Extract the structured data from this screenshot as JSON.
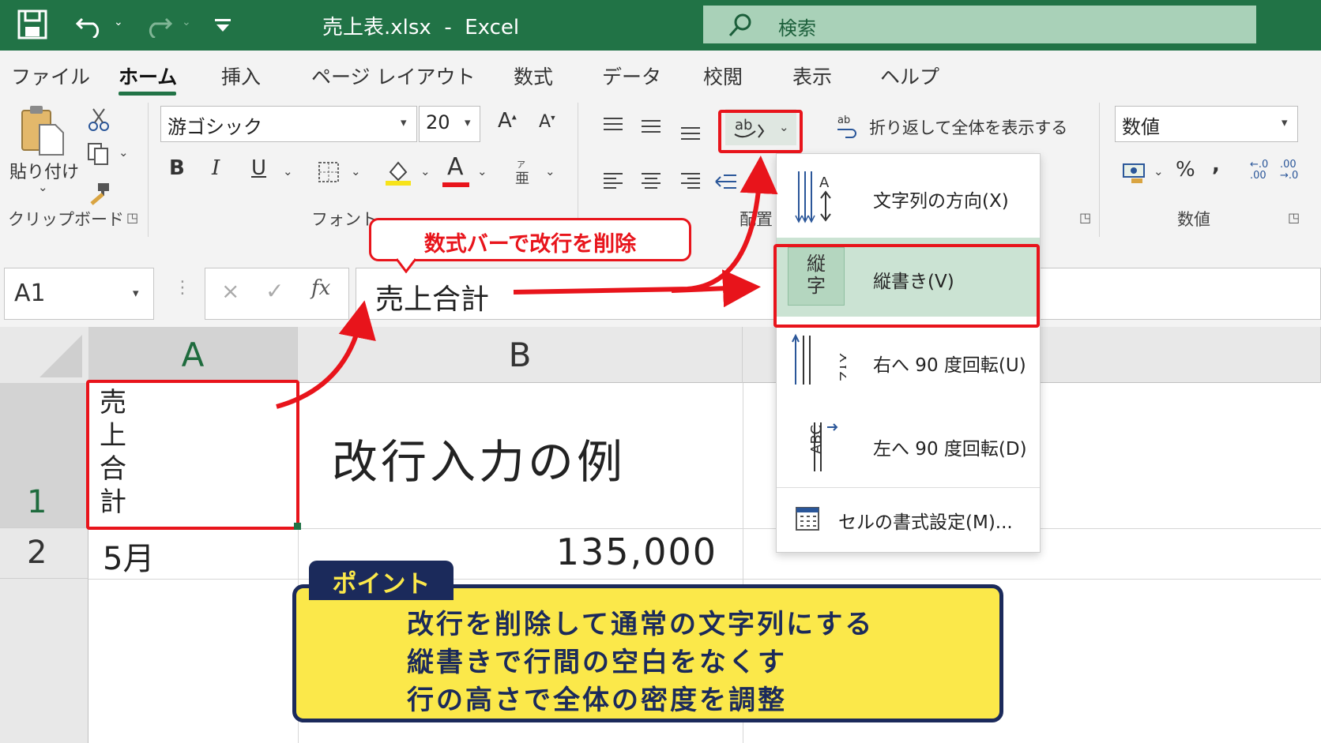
{
  "window": {
    "title": "売上表.xlsx  -  Excel"
  },
  "search": {
    "label": "検索"
  },
  "menu": {
    "items": [
      "ファイル",
      "ホーム",
      "挿入",
      "ページ レイアウト",
      "数式",
      "データ",
      "校閲",
      "表示",
      "ヘルプ"
    ],
    "active": "ホーム"
  },
  "ribbon": {
    "clipboard": {
      "paste_label": "貼り付け",
      "group_label": "クリップボード"
    },
    "font": {
      "font_name": "游ゴシック",
      "font_size": "20",
      "grow": "A",
      "shrink": "A",
      "bold": "B",
      "italic": "I",
      "underline": "U",
      "font_color_letter": "A",
      "group_label": "フォント"
    },
    "alignment": {
      "orientation_label": "ab",
      "wrap_label": "折り返して全体を表示する",
      "group_label": "配置"
    },
    "number": {
      "format": "数値",
      "percent": "%",
      "comma": ",",
      "group_label": "数値",
      "inc_decimal": "←.0 .00",
      "dec_decimal": ".00 →.0"
    }
  },
  "formula_bar": {
    "name_box": "A1",
    "cancel": "×",
    "enter": "✓",
    "fx": "fx",
    "content": "売上合計"
  },
  "sheet": {
    "columns": [
      "A",
      "B"
    ],
    "rows": [
      "1",
      "2"
    ],
    "cells": {
      "A1": [
        "売",
        "上",
        "合",
        "計"
      ],
      "B1": "改行入力の例",
      "A2": "5月",
      "B2": "135,000"
    }
  },
  "orientation_menu": {
    "items": [
      {
        "label": "文字列の方向(X)",
        "icon": "text-direction-icon"
      },
      {
        "label": "縦書き(V)",
        "icon": "vertical-text-icon",
        "icon_text": "縦字",
        "selected": true
      },
      {
        "label": "右へ 90 度回転(U)",
        "icon": "rotate-right-icon"
      },
      {
        "label": "左へ 90 度回転(D)",
        "icon": "rotate-left-icon"
      },
      {
        "label": "セルの書式設定(M)...",
        "icon": "format-cells-icon"
      }
    ]
  },
  "annotations": {
    "callout": "数式バーで改行を削除",
    "point_title": "ポイント",
    "point_lines": [
      "改行を削除して通常の文字列にする",
      "縦書きで行間の空白をなくす",
      "行の高さで全体の密度を調整"
    ],
    "accent": "#e8141b",
    "point_bg": "#fbe84a",
    "point_border": "#1b2a5b"
  },
  "colors": {
    "excel_green": "#217346"
  }
}
